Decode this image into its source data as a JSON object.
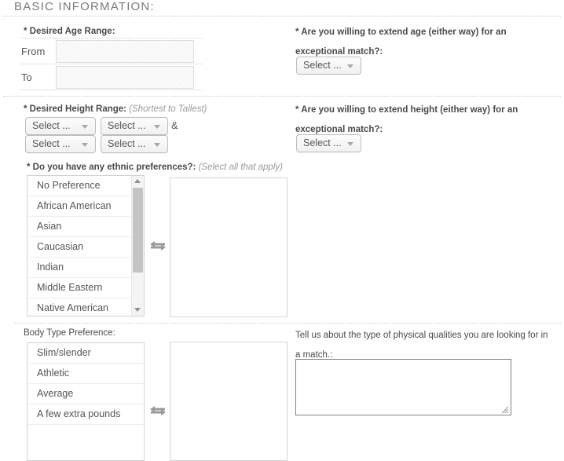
{
  "section": {
    "heading": "BASIC INFORMATION:"
  },
  "age_range": {
    "label": "* Desired Age Range:",
    "rows": [
      {
        "key": "From",
        "value": "",
        "placeholder": ""
      },
      {
        "key": "To",
        "value": "",
        "placeholder": ""
      }
    ]
  },
  "extend_age": {
    "question": "* Are you willing to extend age (either way) for an exceptional match?:",
    "select_label": "Select ..."
  },
  "height_range": {
    "label": "* Desired Height Range:",
    "hint": "(Shortest to Tallest)",
    "amp": "&",
    "selects": [
      {
        "label": "Select ..."
      },
      {
        "label": "Select ..."
      },
      {
        "label": "Select ..."
      },
      {
        "label": "Select ..."
      }
    ]
  },
  "extend_height": {
    "question": "* Are you willing to extend height (either way) for an exceptional match?:",
    "select_label": "Select ..."
  },
  "ethnic": {
    "label": "* Do you have any ethnic preferences?:",
    "hint": "(Select all that apply)",
    "available": [
      "No Preference",
      "African American",
      "Asian",
      "Caucasian",
      "Indian",
      "Middle Eastern",
      "Native American"
    ],
    "selected": [],
    "swap_icon": "swap-arrows-icon"
  },
  "body_type": {
    "label": "Body Type Preference:",
    "available": [
      "Slim/slender",
      "Athletic",
      "Average",
      "A few extra pounds"
    ],
    "selected": [],
    "swap_icon": "swap-arrows-icon"
  },
  "physical_qualities": {
    "question": "Tell us about the type of physical qualities you are looking for in a match.:",
    "value": "",
    "placeholder": ""
  },
  "colors": {
    "heading": "#7a7a7a",
    "label": "#4a4a4a",
    "hint": "#9a9a9a",
    "divider": "#c9c9c9",
    "border": "#d2d2d2",
    "scroll_thumb": "#c4c4c4",
    "icon_gray": "#9b9b9b"
  }
}
